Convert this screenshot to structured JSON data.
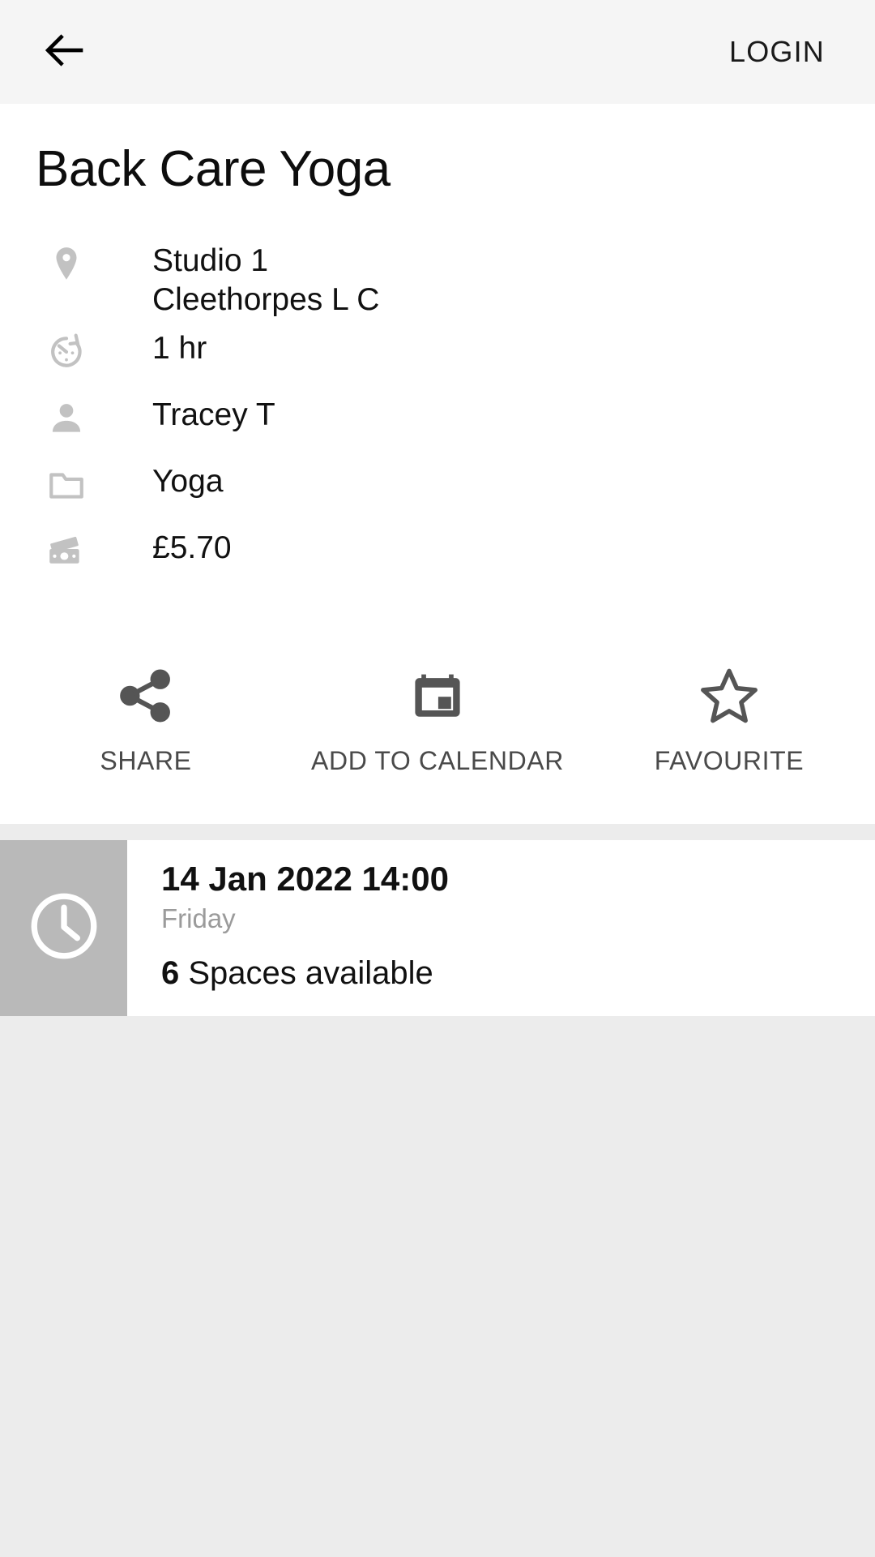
{
  "header": {
    "back_icon": "arrow-left-icon",
    "login_label": "LOGIN"
  },
  "class_detail": {
    "title": "Back Care Yoga",
    "info_rows": [
      {
        "icon": "location-pin-icon",
        "text": "Studio 1\nCleethorpes L C"
      },
      {
        "icon": "timer-icon",
        "text": "1 hr"
      },
      {
        "icon": "person-icon",
        "text": "Tracey T"
      },
      {
        "icon": "folder-icon",
        "text": "Yoga"
      },
      {
        "icon": "money-icon",
        "text": "£5.70"
      }
    ]
  },
  "actions": [
    {
      "icon": "share-icon",
      "label": "SHARE"
    },
    {
      "icon": "calendar-icon",
      "label": "ADD TO CALENDAR"
    },
    {
      "icon": "star-outline-icon",
      "label": "FAVOURITE"
    }
  ],
  "sessions": [
    {
      "thumb_icon": "clock-icon",
      "datetime": "14 Jan 2022 14:00",
      "day": "Friday",
      "spaces_count": "6",
      "spaces_label": "Spaces available"
    }
  ],
  "colors": {
    "header_bg": "#f5f5f5",
    "page_bg": "#ececec",
    "card_bg": "#ffffff",
    "icon_grey": "#c2c2c2",
    "action_grey": "#555555",
    "thumb_bg": "#b9b9b9",
    "muted_text": "#9b9b9b"
  }
}
